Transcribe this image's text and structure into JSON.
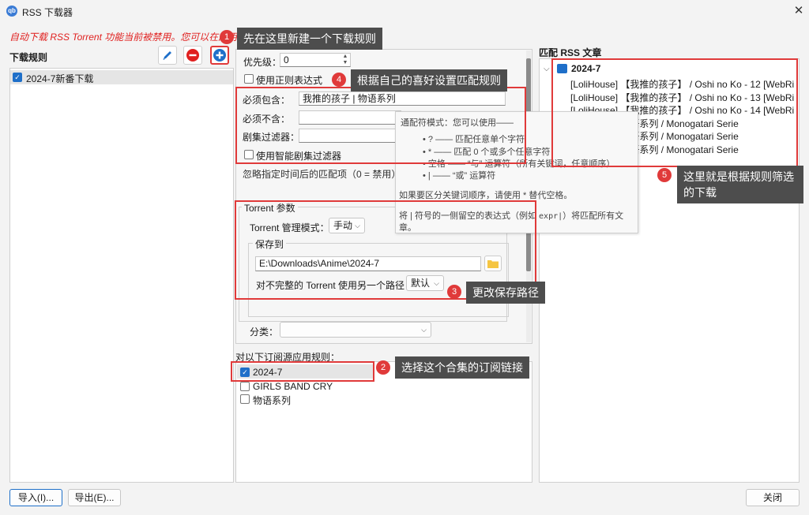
{
  "window": {
    "title": "RSS 下载器"
  },
  "warning_text": "自动下载 RSS Torrent 功能当前被禁用。您可以在应用程序设置中启用它。",
  "rules_panel": {
    "label": "下载规则",
    "items": [
      {
        "label": "2024-7新番下载",
        "checked": true
      }
    ]
  },
  "settings": {
    "priority_label": "优先级：",
    "priority_value": "0",
    "use_regex_label": "使用正则表达式",
    "must_contain_label": "必须包含：",
    "must_contain_value": "我推的孩子 | 物语系列",
    "must_not_contain_label": "必须不含：",
    "must_not_contain_value": "",
    "episode_filter_label": "剧集过滤器：",
    "episode_filter_value": "",
    "smart_filter_label": "使用智能剧集过滤器",
    "ignore_label": "忽略指定时间后的匹配项（0 = 禁用）",
    "torrent_params_label": "Torrent 参数",
    "torrent_mode_label": "Torrent 管理模式：",
    "torrent_mode_value": "手动",
    "save_to_label": "保存到",
    "save_path_value": "E:\\Downloads\\Anime\\2024-7",
    "incomplete_label": "对不完整的 Torrent 使用另一个路径：",
    "incomplete_value": "默认",
    "category_label": "分类：",
    "category_value": ""
  },
  "feeds": {
    "label": "对以下订阅源应用规则：",
    "items": [
      {
        "label": "2024-7",
        "checked": true
      },
      {
        "label": "GIRLS BAND CRY",
        "checked": false
      },
      {
        "label": "物语系列",
        "checked": false
      }
    ]
  },
  "tooltip": {
    "title": "通配符模式：您可以使用——",
    "lines": [
      "• ? —— 匹配任意单个字符",
      "• * —— 匹配 0 个或多个任意字符",
      "• 空格 —— “与” 运算符（所有关键词，任意顺序）",
      "• | —— “或” 运算符"
    ],
    "note1": "如果要区分关键词顺序，请使用 * 替代空格。",
    "note2_a": "将 | 符号的一侧留空的表达式（例如 ",
    "note2_code": "expr|",
    "note2_b": "）将匹配所有文",
    "note2_c": "章。"
  },
  "articles": {
    "label": "匹配 RSS 文章",
    "group": "2024-7",
    "items": [
      "[LoliHouse] 【我推的孩子】 / Oshi no Ko - 12 [WebRi",
      "[LoliHouse] 【我推的孩子】 / Oshi no Ko - 13 [WebRi",
      "[LoliHouse] 【我推的孩子】 / Oshi no Ko - 14 [WebRi",
      "[LoliHouse] 物语系列 / Monogatari Serie",
      "[LoliHouse] 物语系列 / Monogatari Serie",
      "[LoliHouse] 物语系列 / Monogatari Serie"
    ]
  },
  "buttons": {
    "import": "导入(I)...",
    "export": "导出(E)...",
    "close": "关闭"
  },
  "annotations": {
    "a1": {
      "num": "1",
      "text": "先在这里新建一个下载规则"
    },
    "a2": {
      "num": "2",
      "text": "选择这个合集的订阅链接"
    },
    "a3": {
      "num": "3",
      "text": "更改保存路径"
    },
    "a4": {
      "num": "4",
      "text": "根据自己的喜好设置匹配规则"
    },
    "a5": {
      "num": "5",
      "text_line1": "这里就是根据规则筛选",
      "text_line2": "的下载"
    }
  },
  "colors": {
    "accent": "#1e6fc9",
    "annotation_red": "#e03a3a",
    "warning_red": "#e0201f",
    "callout_bg": "#4d4d4d"
  },
  "icons": [
    "edit-icon",
    "remove-icon",
    "add-icon",
    "folder-icon",
    "close-icon",
    "chevron-down-icon",
    "rss-folder-icon"
  ]
}
